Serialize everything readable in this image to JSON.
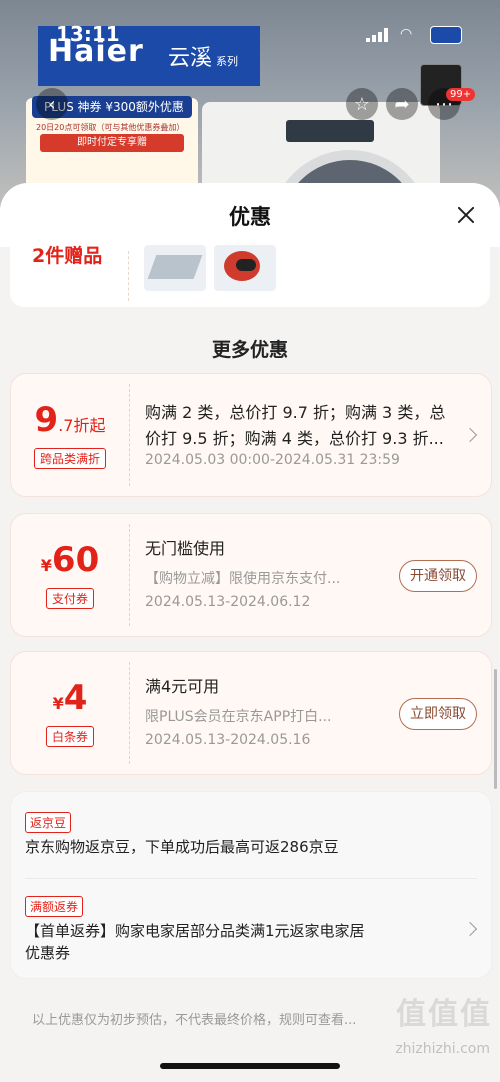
{
  "status_bar": {
    "time": "13:11"
  },
  "background": {
    "brand_left": "Haier",
    "brand_right": "云溪",
    "brand_series": "系列",
    "promo_top": "PLUS 神券  ¥300额外优惠",
    "promo_mid": "20日20点可领取（可与其他优惠券叠加）",
    "promo_red": "即时付定专享赠",
    "shop_badge": "99+"
  },
  "sheet": {
    "title": "优惠"
  },
  "gift": {
    "label": "2件赠品"
  },
  "more_section": {
    "title": "更多优惠"
  },
  "coupons": [
    {
      "symbol": "",
      "amount": "9",
      "suffix": ".7折起",
      "tag": "跨品类满折",
      "title": "购满2类，总价打9.7折；购满3类，总价打9.5折；购满4类，总价打9.3折...",
      "title_line1": "购满 2 类，总价打 9.7 折；购满 3 类，总",
      "title_line2": "价打 9.5 折；购满 4 类，总价打 9.3 折...",
      "date": "2024.05.03 00:00-2024.05.31 23:59"
    },
    {
      "symbol": "¥",
      "amount": "60",
      "suffix": "",
      "tag": "支付券",
      "title": "无门槛使用",
      "desc": "【购物立减】限使用京东支付...",
      "date": "2024.05.13-2024.06.12",
      "button": "开通领取"
    },
    {
      "symbol": "¥",
      "amount": "4",
      "suffix": "",
      "tag": "白条券",
      "title": "满4元可用",
      "desc": "限PLUS会员在京东APP打白...",
      "date": "2024.05.13-2024.05.16",
      "button": "立即领取"
    }
  ],
  "rebates": [
    {
      "tag": "返京豆",
      "text": "京东购物返京豆，下单成功后最高可返286京豆"
    },
    {
      "tag": "满额返券",
      "text_line1": "【首单返券】购家电家居部分品类满1元返家电家居",
      "text_line2": "优惠券"
    }
  ],
  "footer": {
    "note": "以上优惠仅为初步预估，不代表最终价格，规则可查看..."
  },
  "watermark": {
    "text": "值值值",
    "url": "zhizhizhi.com"
  },
  "colors": {
    "accent": "#e2231a",
    "button_border": "#b56d52",
    "sheet_bg": "#f4f3f2"
  }
}
